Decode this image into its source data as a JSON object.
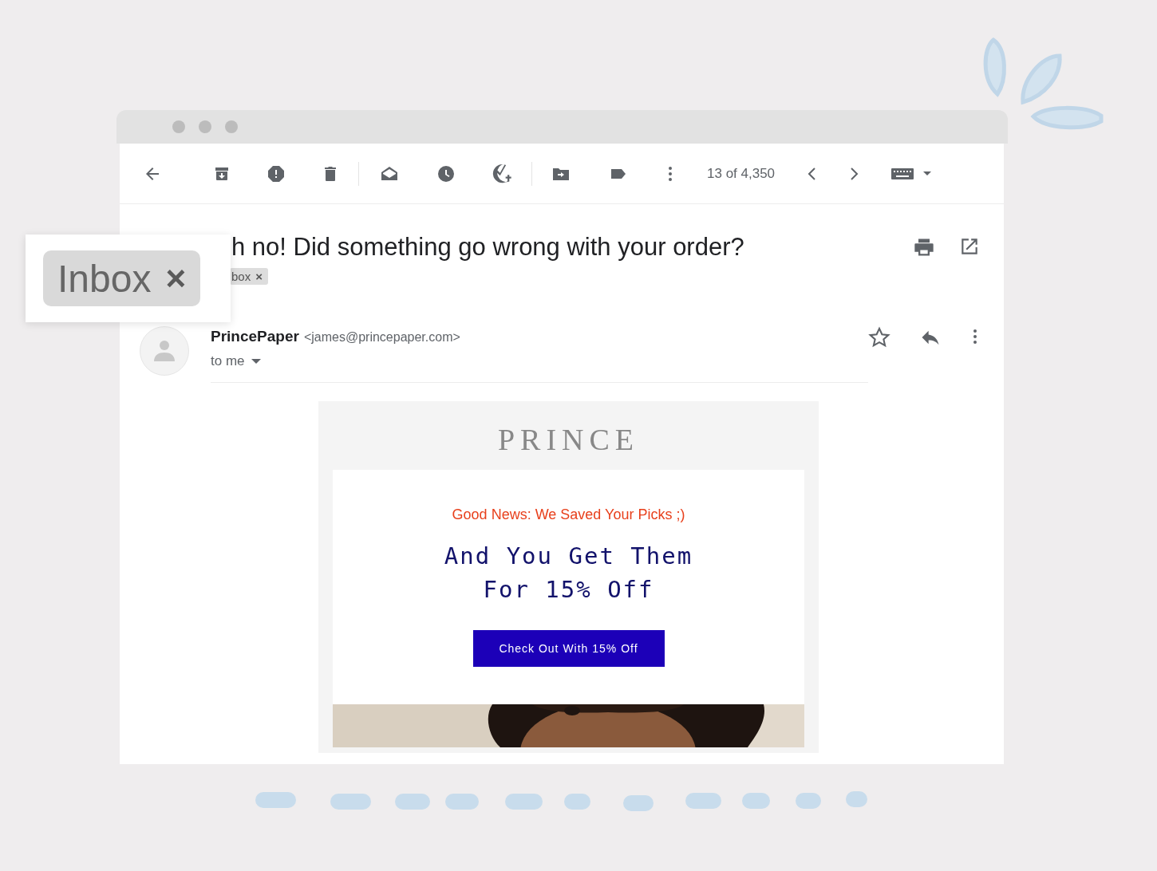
{
  "toolbar": {
    "counter": "13 of 4,350"
  },
  "message": {
    "subject": "h no! Did something go wrong with your order?",
    "label_chip": {
      "label": "box",
      "remove": "×"
    },
    "sender": {
      "name": "PrincePaper",
      "email": "<james@princepaper.com>",
      "recipient": "to me"
    }
  },
  "email_body": {
    "logo": "PRINCE",
    "eyebrow": "Good News: We Saved Your Picks ;)",
    "headline": "And You Get Them For 15% Off",
    "button": "Check Out With 15% Off"
  },
  "callout": {
    "label": "Inbox",
    "remove": "×"
  }
}
